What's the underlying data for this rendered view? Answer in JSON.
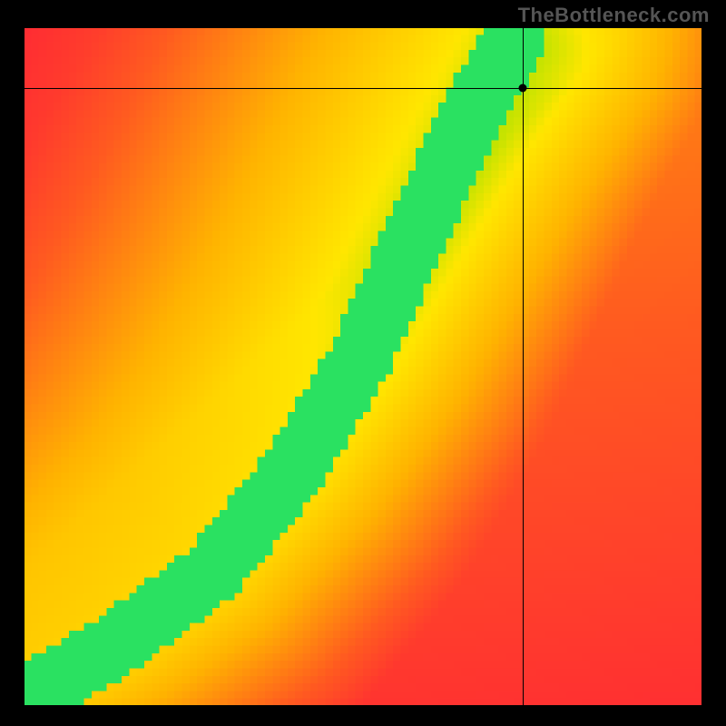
{
  "watermark": "TheBottleneck.com",
  "chart_data": {
    "type": "heatmap",
    "title": "",
    "xlabel": "",
    "ylabel": "",
    "xlim": [
      0,
      1
    ],
    "ylim": [
      0,
      1
    ],
    "grid": false,
    "legend": false,
    "colormap_stops": [
      {
        "t": 0.0,
        "color": "#ff1a3a"
      },
      {
        "t": 0.25,
        "color": "#ff5a20"
      },
      {
        "t": 0.5,
        "color": "#ffb300"
      },
      {
        "t": 0.72,
        "color": "#ffe600"
      },
      {
        "t": 0.9,
        "color": "#8be000"
      },
      {
        "t": 1.0,
        "color": "#00e28a"
      }
    ],
    "ridge": {
      "description": "Green optimal ridge where CPU and GPU are balanced; curve approximated as piecewise control points on the 0..1 unit square, origin at bottom-left",
      "points": [
        {
          "x": 0.02,
          "y": 0.02
        },
        {
          "x": 0.15,
          "y": 0.1
        },
        {
          "x": 0.28,
          "y": 0.2
        },
        {
          "x": 0.4,
          "y": 0.35
        },
        {
          "x": 0.5,
          "y": 0.52
        },
        {
          "x": 0.58,
          "y": 0.7
        },
        {
          "x": 0.65,
          "y": 0.85
        },
        {
          "x": 0.72,
          "y": 0.98
        }
      ],
      "width_normalized": 0.055
    },
    "marker": {
      "x": 0.735,
      "y": 0.91,
      "crosshair": true
    },
    "render_resolution": 90
  }
}
